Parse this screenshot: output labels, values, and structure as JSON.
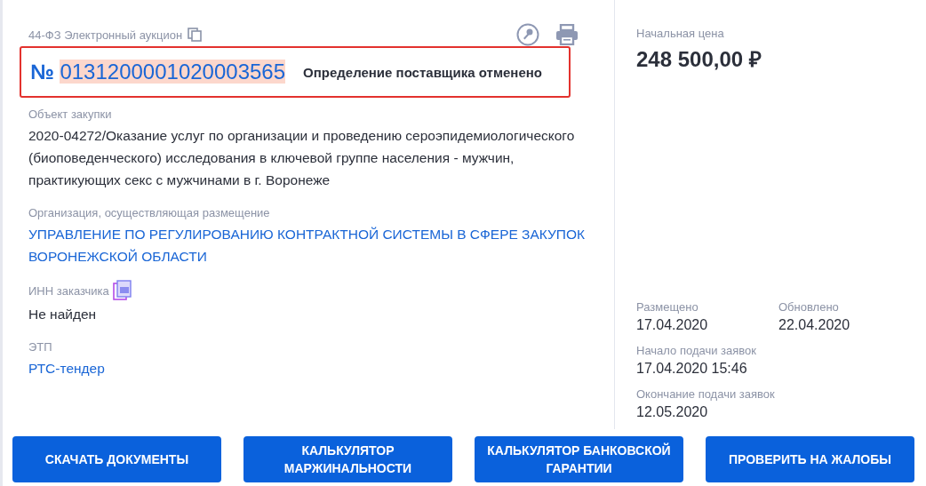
{
  "procurement_type": "44-ФЗ Электронный аукцион",
  "header": {
    "outlined": true,
    "number_sign": "№",
    "number": "0131200001020003565",
    "number_highlighted": true,
    "status": "Определение поставщика отменено"
  },
  "fields": [
    {
      "kind": "text",
      "label": "Объект закупки",
      "value": "2020-04272/Оказание услуг по организации и проведению сероэпидемиологического (биоповеденческого) исследования в ключевой группе населения - мужчин, практикующих секс с мужчинами в г. Воронеже"
    },
    {
      "kind": "link",
      "label": "Организация, осуществляющая размещение",
      "value": "УПРАВЛЕНИЕ ПО РЕГУЛИРОВАНИЮ КОНТРАКТНОЙ СИСТЕМЫ В СФЕРЕ ЗАКУПОК ВОРОНЕЖСКОЙ ОБЛАСТИ"
    },
    {
      "kind": "copy",
      "label": "ИНН заказчика",
      "value": "Не найден"
    },
    {
      "kind": "link",
      "label": "ЭТП",
      "value": "РТС-тендер"
    }
  ],
  "price": {
    "label": "Начальная цена",
    "value": "248 500,00 ₽"
  },
  "dates": [
    {
      "label": "Размещено",
      "value": "17.04.2020"
    },
    {
      "label": "Обновлено",
      "value": "22.04.2020"
    },
    {
      "label": "Начало подачи заявок",
      "value": "17.04.2020 15:46"
    },
    {
      "label": "Окончание подачи заявок",
      "value": "12.05.2020"
    }
  ],
  "buttons": [
    "СКАЧАТЬ ДОКУМЕНТЫ",
    "КАЛЬКУЛЯТОР МАРЖИНАЛЬНОСТИ",
    "КАЛЬКУЛЯТОР БАНКОВСКОЙ ГАРАНТИИ",
    "ПРОВЕРИТЬ НА ЖАЛОБЫ"
  ]
}
